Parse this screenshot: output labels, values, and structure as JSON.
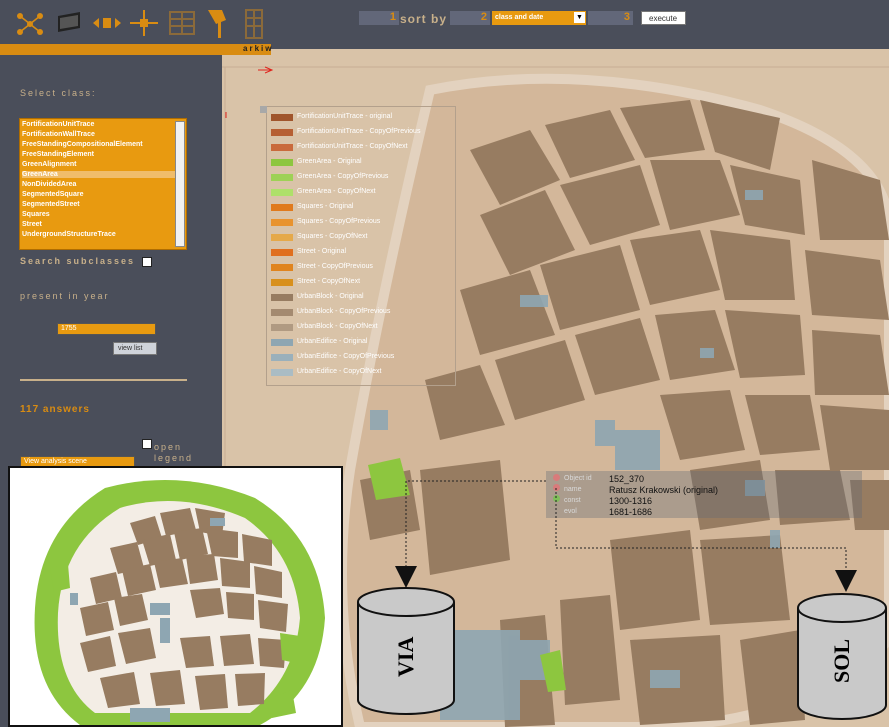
{
  "toolbar": {
    "tools": [
      "network-icon",
      "panel-icon",
      "arrows-icon",
      "crosshair-icon",
      "grid-icon",
      "pin-icon",
      "building-icon"
    ],
    "brand": "arkiw"
  },
  "sort": {
    "num1": "1",
    "label": "sort by",
    "num2": "2",
    "select_value": "class and date",
    "num3": "3",
    "execute_label": "execute"
  },
  "sidebar": {
    "select_class_label": "Select class:",
    "classes": [
      "FortificationUnitTrace",
      "FortificationWallTrace",
      "FreeStandingCompositionalElement",
      "FreeStandingElement",
      "GreenAlignment",
      "GreenArea",
      "NonDividedArea",
      "SegmentedSquare",
      "SegmentedStreet",
      "Squares",
      "Street",
      "UndergroundStructureTrace"
    ],
    "selected_class": "GreenArea",
    "search_subclasses_label": "Search subclasses",
    "present_in_year_label": "present in year",
    "year_value": "1755",
    "view_list_label": "view list",
    "answers_label": "117 answers",
    "open_legend_label": "open legend",
    "view_scene_label": "View analysis scene"
  },
  "legend": [
    {
      "label": "FortificationUnitTrace - original",
      "color": "#a0552c"
    },
    {
      "label": "FortificationUnitTrace - CopyOfPrevious",
      "color": "#b65f33"
    },
    {
      "label": "FortificationUnitTrace - CopyOfNext",
      "color": "#c96a3c"
    },
    {
      "label": "GreenArea - Original",
      "color": "#8dc63f"
    },
    {
      "label": "GreenArea - CopyOfPrevious",
      "color": "#9ed156"
    },
    {
      "label": "GreenArea - CopyOfNext",
      "color": "#aee06a"
    },
    {
      "label": "Squares - Original",
      "color": "#e07a1c"
    },
    {
      "label": "Squares - CopyOfPrevious",
      "color": "#e8932e"
    },
    {
      "label": "Squares - CopyOfNext",
      "color": "#e5a94a"
    },
    {
      "label": "Street - Original",
      "color": "#e06f1e"
    },
    {
      "label": "Street - CopyOfPrevious",
      "color": "#e0841e"
    },
    {
      "label": "Street - CopyOfNext",
      "color": "#d8901c"
    },
    {
      "label": "UrbanBlock - Original",
      "color": "#977c61"
    },
    {
      "label": "UrbanBlock - CopyOfPrevious",
      "color": "#a48a70"
    },
    {
      "label": "UrbanBlock - CopyOfNext",
      "color": "#b09a82"
    },
    {
      "label": "UrbanEdifice - Original",
      "color": "#8ea6b2"
    },
    {
      "label": "UrbanEdifice - CopyOfPrevious",
      "color": "#9ab0bb"
    },
    {
      "label": "UrbanEdifice - CopyOfNext",
      "color": "#aabcc4"
    }
  ],
  "tooltip": {
    "rows": [
      {
        "key": "Object id",
        "value": "152_370",
        "icon": "red-dot"
      },
      {
        "key": "name",
        "value": "Ratusz Krakowski (original)",
        "icon": "red-dot"
      },
      {
        "key": "const",
        "value": "1300-1316",
        "icon": "green-dot"
      },
      {
        "key": "evol",
        "value": "1681-1686",
        "icon": "none"
      }
    ]
  },
  "databases": {
    "left": "VIA",
    "right": "SOL"
  },
  "colors": {
    "panel": "#4a4e5a",
    "accent": "#e89a10",
    "map_bg": "#d9c3a8",
    "block": "#977c61",
    "edifice": "#8ea6b2",
    "green": "#8dc63f"
  }
}
